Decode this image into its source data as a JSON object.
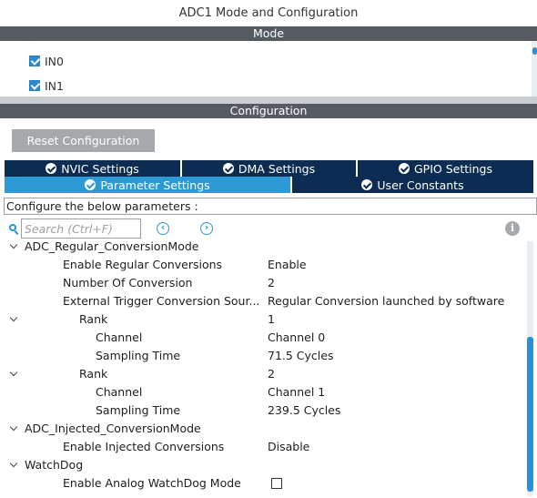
{
  "window": {
    "title": "ADC1 Mode and Configuration"
  },
  "mode": {
    "header": "Mode",
    "items": [
      {
        "label": "IN0",
        "checked": true
      },
      {
        "label": "IN1",
        "checked": true
      }
    ]
  },
  "configuration": {
    "header": "Configuration",
    "reset_label": "Reset Configuration",
    "tabs_top": [
      {
        "label": "NVIC Settings",
        "icon": "check-circle-icon"
      },
      {
        "label": "DMA Settings",
        "icon": "check-circle-icon"
      },
      {
        "label": "GPIO Settings",
        "icon": "check-circle-icon"
      }
    ],
    "tabs_bottom": [
      {
        "label": "Parameter Settings",
        "icon": "check-circle-icon",
        "active": true
      },
      {
        "label": "User Constants",
        "icon": "check-circle-icon",
        "active": false
      }
    ],
    "configure_text": "Configure the below parameters :",
    "search_placeholder": "Search (Ctrl+F)",
    "params": [
      {
        "label": "ADC_Regular_ConversionMode",
        "value": ""
      },
      {
        "label": "Enable Regular Conversions",
        "value": "Enable"
      },
      {
        "label": "Number Of Conversion",
        "value": "2"
      },
      {
        "label": "External Trigger Conversion Sour...",
        "value": "Regular Conversion launched by software"
      },
      {
        "label": "Rank",
        "value": "1"
      },
      {
        "label": "Channel",
        "value": "Channel 0"
      },
      {
        "label": "Sampling Time",
        "value": "71.5 Cycles"
      },
      {
        "label": "Rank",
        "value": "2"
      },
      {
        "label": "Channel",
        "value": "Channel 1"
      },
      {
        "label": "Sampling Time",
        "value": "239.5 Cycles"
      },
      {
        "label": "ADC_Injected_ConversionMode",
        "value": ""
      },
      {
        "label": "Enable Injected Conversions",
        "value": "Disable"
      },
      {
        "label": "WatchDog",
        "value": ""
      },
      {
        "label": "Enable Analog WatchDog Mode",
        "value": "",
        "checkbox": false
      }
    ]
  },
  "colors": {
    "header_bar": "#555b61",
    "tab_dark": "#0c2c52",
    "tab_active": "#2d9ad6",
    "accent": "#2d8fd4"
  }
}
